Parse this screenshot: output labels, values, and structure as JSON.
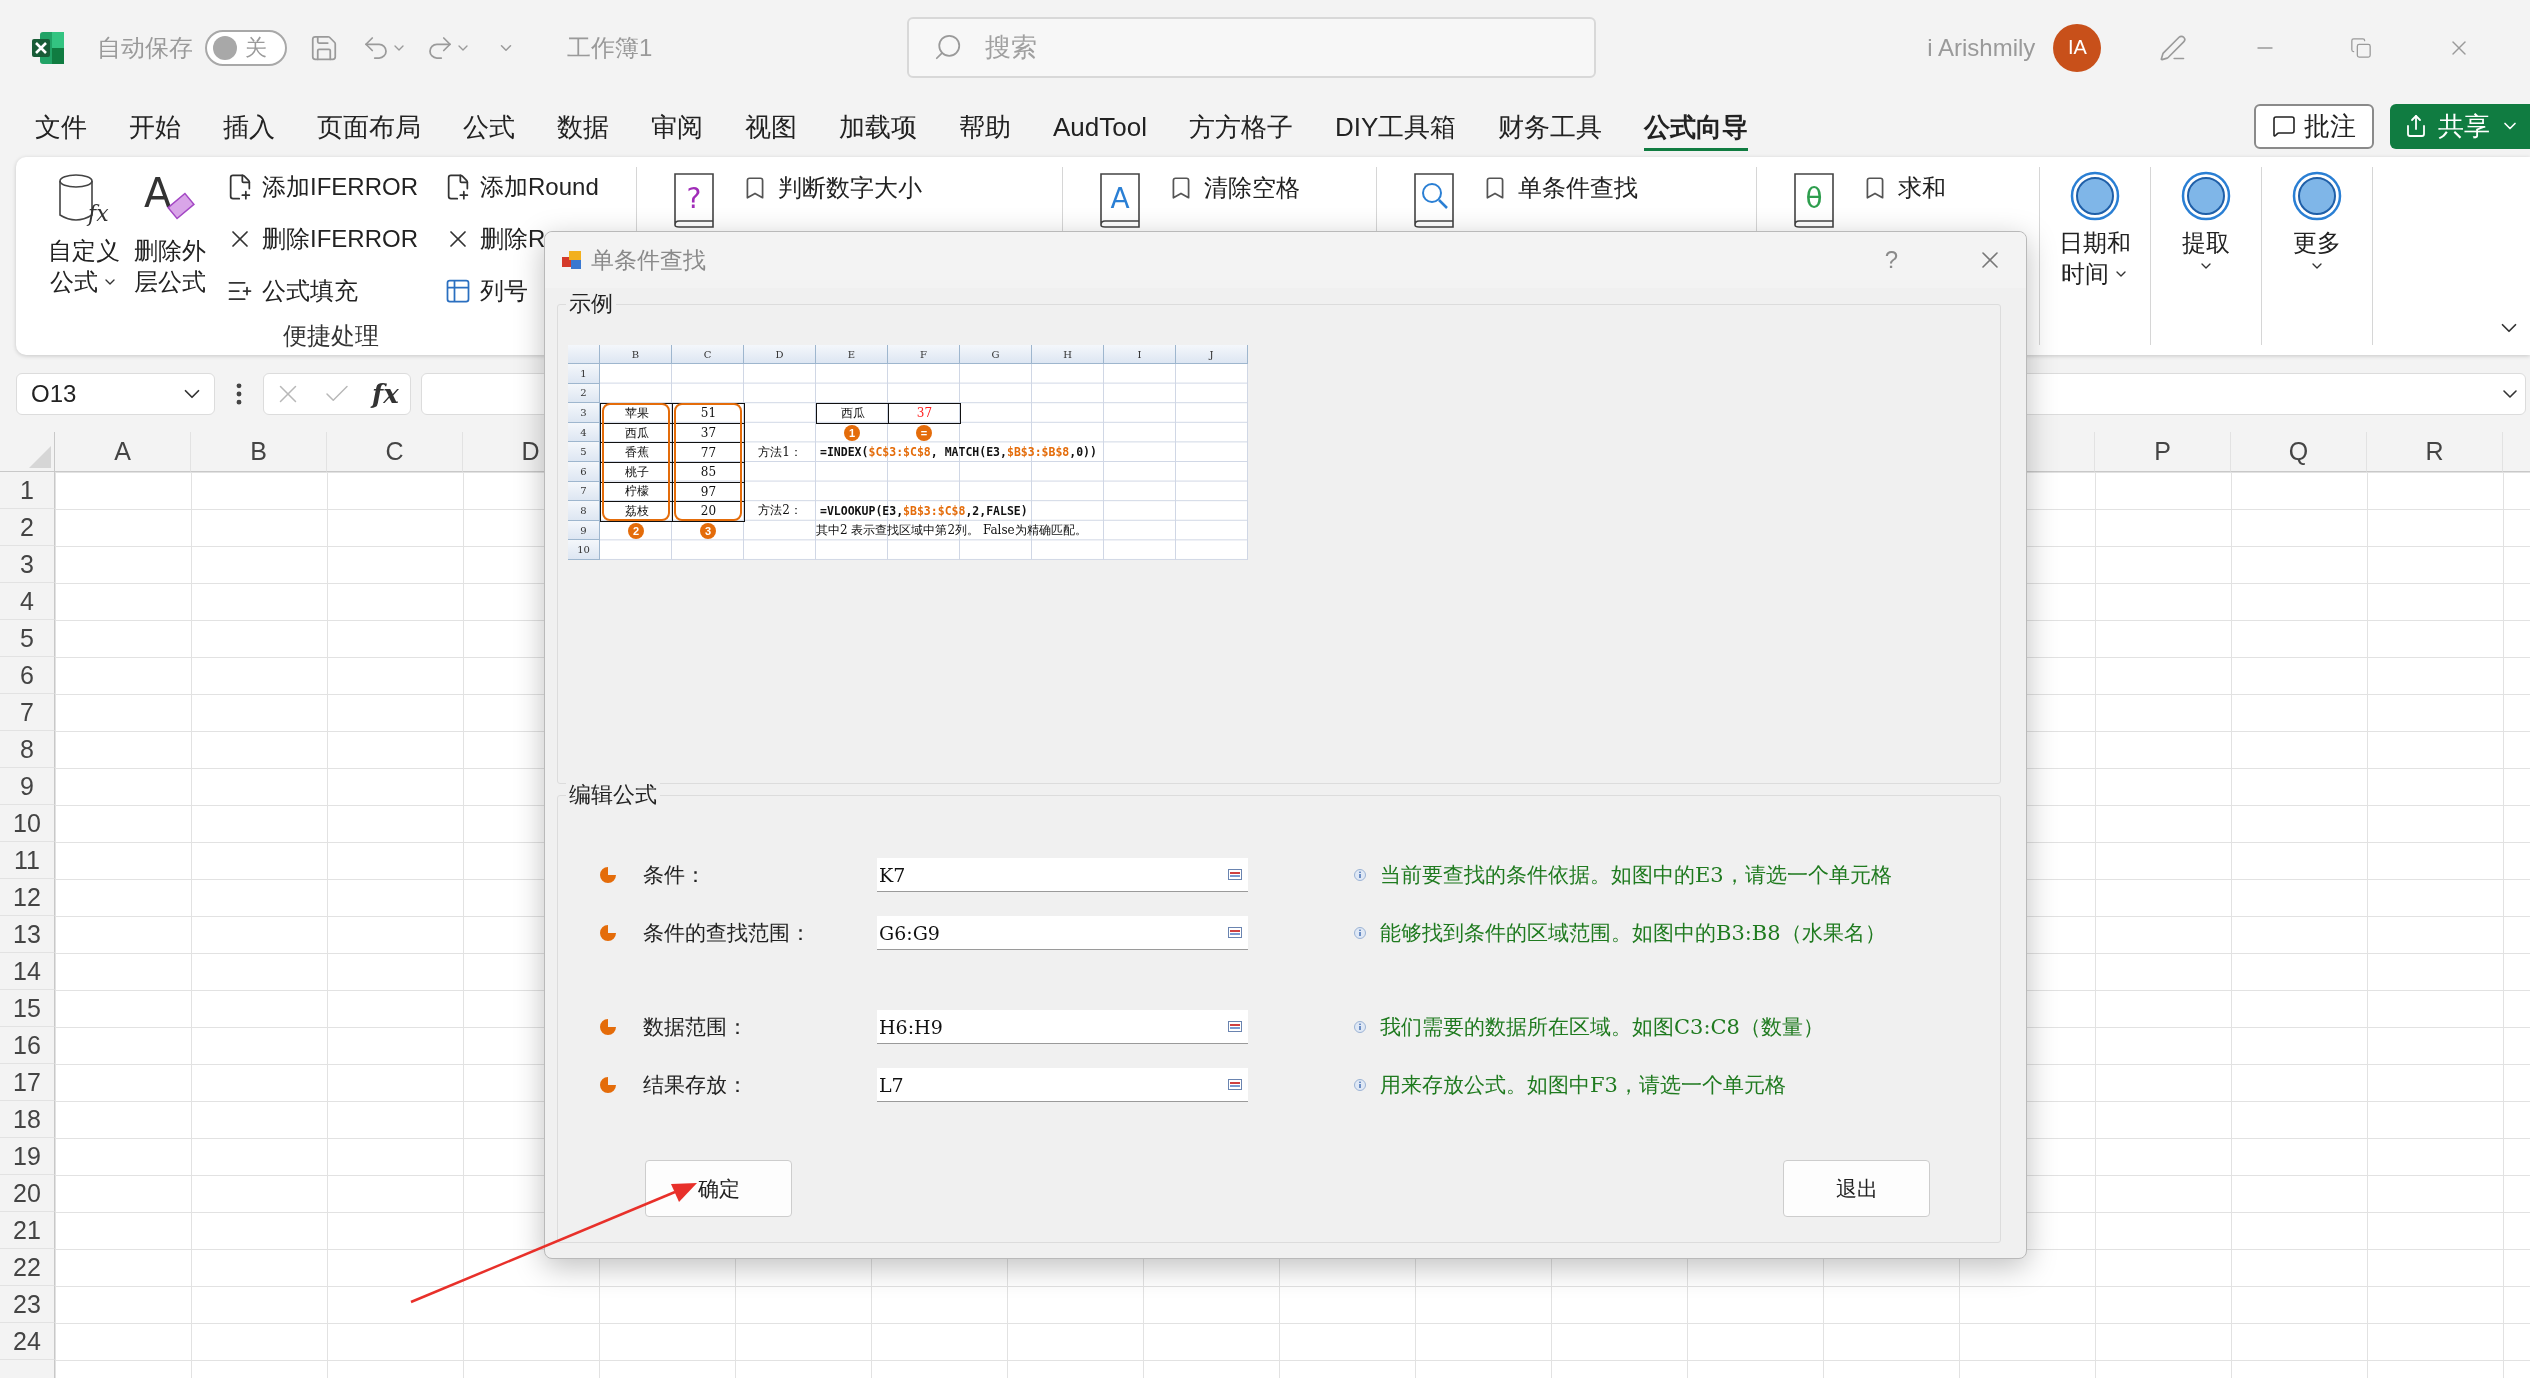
{
  "title_bar": {
    "autosave_label": "自动保存",
    "autosave_on": false,
    "autosave_state": "关",
    "document": "工作簿1",
    "search_placeholder": "搜索",
    "user": "i Arishmily",
    "avatar": "IA"
  },
  "menu_tabs": [
    {
      "label": "文件",
      "selected": false
    },
    {
      "label": "开始",
      "selected": false
    },
    {
      "label": "插入",
      "selected": false
    },
    {
      "label": "页面布局",
      "selected": false
    },
    {
      "label": "公式",
      "selected": false
    },
    {
      "label": "数据",
      "selected": false
    },
    {
      "label": "审阅",
      "selected": false
    },
    {
      "label": "视图",
      "selected": false
    },
    {
      "label": "加载项",
      "selected": false
    },
    {
      "label": "帮助",
      "selected": false
    },
    {
      "label": "AudTool",
      "selected": false
    },
    {
      "label": "方方格子",
      "selected": false
    },
    {
      "label": "DIY工具箱",
      "selected": false
    },
    {
      "label": "财务工具",
      "selected": false
    },
    {
      "label": "公式向导",
      "selected": true
    }
  ],
  "comments_button": "批注",
  "share_button": "共享",
  "ribbon": {
    "big_buttons": [
      {
        "glyph": "fx",
        "kind": "cylinder",
        "lines": [
          "自定义",
          "公式"
        ],
        "dropdown": true
      },
      {
        "glyph": "A",
        "kind": "eraser",
        "lines": [
          "删除外",
          "层公式"
        ],
        "dropdown": false
      }
    ],
    "small_columns": [
      [
        {
          "label": "添加IFERROR",
          "kind": "add"
        },
        {
          "label": "删除IFERROR",
          "kind": "remove"
        },
        {
          "label": "公式填充",
          "kind": "fill"
        }
      ],
      [
        {
          "label": "添加Round",
          "kind": "add"
        },
        {
          "label": "删除R",
          "kind": "remove"
        },
        {
          "label": "列号",
          "kind": "table"
        }
      ]
    ],
    "group_label": "便捷处理",
    "book_groups": [
      {
        "kind": "glyph",
        "glyph": "?",
        "label": "判断数字大小"
      },
      {
        "kind": "glyph",
        "glyph": "A",
        "label": "清除空格"
      },
      {
        "kind": "search",
        "label": "单条件查找"
      },
      {
        "kind": "glyph",
        "glyph": "θ",
        "label": "求和"
      }
    ],
    "menus": [
      {
        "lines": [
          "日期和",
          "时间"
        ],
        "dropdown": true
      },
      {
        "lines": [
          "提取"
        ],
        "dropdown": true
      },
      {
        "lines": [
          "更多"
        ],
        "dropdown": true
      }
    ]
  },
  "formula_bar": {
    "name_box": "O13",
    "function_symbol": "fx"
  },
  "sheet": {
    "columns_before_dialog": [
      "A",
      "B",
      "C",
      "D"
    ],
    "columns_after_dialog": [
      "P",
      "Q",
      "R"
    ],
    "rows": [
      "1",
      "2",
      "3",
      "4",
      "5",
      "6",
      "7",
      "8",
      "9",
      "10",
      "11",
      "12",
      "13",
      "14",
      "15",
      "16",
      "17",
      "18",
      "19",
      "20",
      "21",
      "22",
      "23",
      "24"
    ]
  },
  "dialog": {
    "title": "单条件查找",
    "help": "?",
    "example_legend": "示例",
    "example": {
      "columns": [
        "B",
        "C",
        "D",
        "E",
        "F",
        "G",
        "H",
        "I",
        "J"
      ],
      "rows": [
        "1",
        "2",
        "3",
        "4",
        "5",
        "6",
        "7",
        "8",
        "9",
        "10"
      ],
      "items": [
        {
          "name": "苹果",
          "value": "51"
        },
        {
          "name": "西瓜",
          "value": "37"
        },
        {
          "name": "香蕉",
          "value": "77"
        },
        {
          "name": "桃子",
          "value": "85"
        },
        {
          "name": "柠檬",
          "value": "97"
        },
        {
          "name": "荔枝",
          "value": "20"
        }
      ],
      "lookup": {
        "key": "西瓜",
        "result": "37"
      },
      "badges": [
        "1",
        "=",
        "2",
        "3"
      ],
      "method1": {
        "label": "方法1：",
        "parts": [
          {
            "text": "=INDEX(",
            "highlighted": false
          },
          {
            "text": "$C$3:$C$8",
            "highlighted": true
          },
          {
            "text": ", MATCH(E3,",
            "highlighted": false
          },
          {
            "text": "$B$3:$B$8",
            "highlighted": true
          },
          {
            "text": ",0))",
            "highlighted": false
          }
        ]
      },
      "method2": {
        "label": "方法2：",
        "parts": [
          {
            "text": "=VLOOKUP(E3,",
            "highlighted": false
          },
          {
            "text": "$B$3:$C$8",
            "highlighted": true
          },
          {
            "text": ",2,FALSE)",
            "highlighted": false
          }
        ]
      },
      "note": "其中2 表示查找区域中第2列。 False为精确匹配。"
    },
    "edit_legend": "编辑公式",
    "fields": [
      {
        "label": "条件：",
        "value": "K7",
        "hint": "当前要查找的条件依据。如图中的E3，请选一个单元格"
      },
      {
        "label": "条件的查找范围：",
        "value": "G6:G9",
        "hint": "能够找到条件的区域范围。如图中的B3:B8（水果名）"
      },
      {
        "label": "数据范围：",
        "value": "H6:H9",
        "hint": "我们需要的数据所在区域。如图C3:C8（数量）"
      },
      {
        "label": "结果存放：",
        "value": "L7",
        "hint": "用来存放公式。如图中F3，请选一个单元格"
      }
    ],
    "ok_button": "确定",
    "cancel_button": "退出"
  }
}
